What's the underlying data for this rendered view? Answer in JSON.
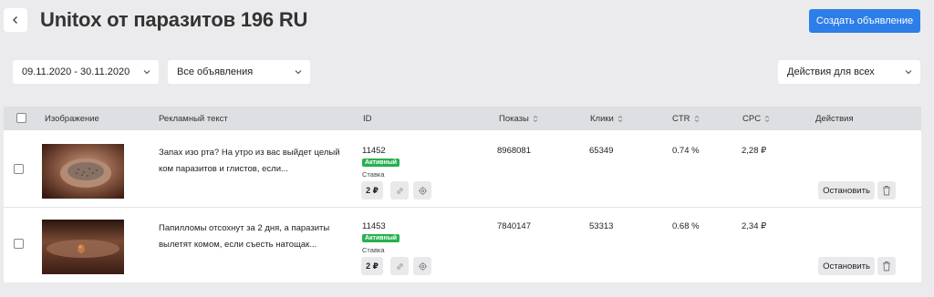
{
  "header": {
    "title": "Unitox от паразитов 196 RU",
    "create_button": "Создать объявление"
  },
  "filters": {
    "date_range": "09.11.2020 - 30.11.2020",
    "ads_filter": "Все объявления",
    "bulk_actions": "Действия для всех"
  },
  "table": {
    "columns": {
      "image": "Изображение",
      "ad_text": "Рекламный текст",
      "id": "ID",
      "impressions": "Показы",
      "clicks": "Клики",
      "ctr": "CTR",
      "cpc": "CPC",
      "actions": "Действия"
    },
    "rows": [
      {
        "text": "Запах изо рта? На утро из вас выйдет целый ком паразитов и глистов, если...",
        "id": "11452",
        "status": "Активный",
        "rate_label": "Ставка",
        "bid": "2 ₽",
        "impressions": "8968081",
        "clicks": "65349",
        "ctr": "0.74 %",
        "cpc": "2,28 ₽",
        "stop": "Остановить"
      },
      {
        "text": "Папилломы отсохнут за 2 дня, а паразиты вылетят комом, если съесть натощак...",
        "id": "11453",
        "status": "Активный",
        "rate_label": "Ставка",
        "bid": "2 ₽",
        "impressions": "7840147",
        "clicks": "53313",
        "ctr": "0.68 %",
        "cpc": "2,34 ₽",
        "stop": "Остановить"
      }
    ]
  },
  "colors": {
    "accent": "#2d7ee8",
    "status_active": "#27b04f",
    "background": "#ebebed",
    "header_row": "#dddfe2"
  },
  "icons": [
    "chevron-left-icon",
    "chevron-down-icon",
    "sort-icon",
    "link-icon",
    "gear-icon",
    "trash-icon"
  ]
}
